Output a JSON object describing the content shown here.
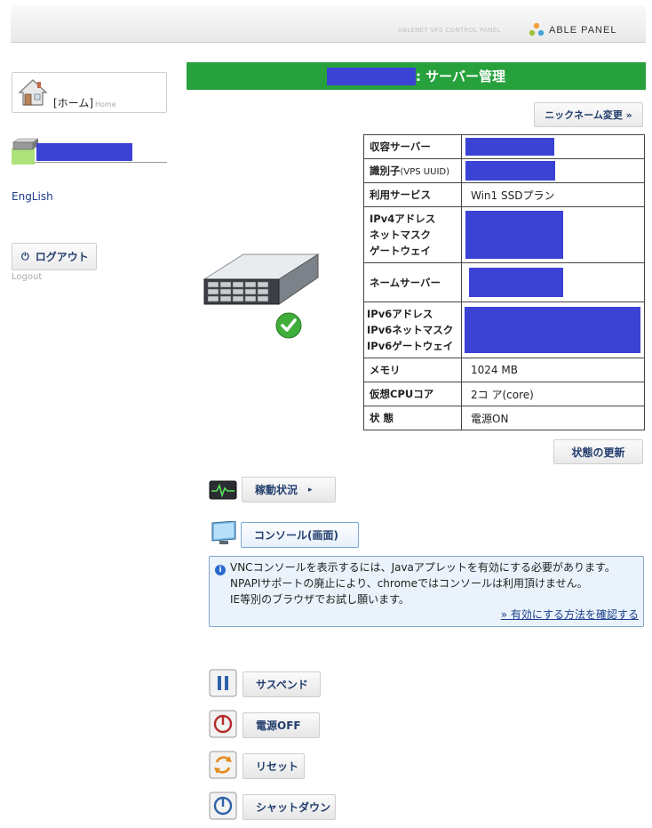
{
  "header": {
    "tagline": "ABLENET VPS CONTROL PANEL",
    "logo_text": "ABLE PANEL"
  },
  "sidebar": {
    "home_label": "[ホーム]",
    "home_sub": "Home",
    "english_link": "EngLish",
    "logout_label": "ログアウト",
    "logout_sub": "Logout"
  },
  "main": {
    "title_suffix": ": サーバー管理",
    "nickname_button": "ニックネーム変更 »",
    "update_button": "状態の更新"
  },
  "info_table": {
    "rows": [
      {
        "key": "収容サーバー",
        "value": ""
      },
      {
        "key": "識別子",
        "key_small": "(VPS UUID)",
        "value": ""
      },
      {
        "key": "利用サービス",
        "value": "Win1 SSDプラン"
      },
      {
        "key_lines": [
          "IPv4アドレス",
          "ネットマスク",
          "ゲートウェイ"
        ],
        "value": ""
      },
      {
        "key": "ネームサーバー",
        "value": ""
      },
      {
        "key_lines": [
          "IPv6アドレス",
          "IPv6ネットマスク",
          "IPv6ゲートウェイ"
        ],
        "value": ""
      },
      {
        "key": "メモリ",
        "value": "1024 MB"
      },
      {
        "key": "仮想CPUコア",
        "value": "2コ ア(core)"
      },
      {
        "key": "状 態",
        "value": "電源ON"
      }
    ]
  },
  "actions": {
    "status_label": "稼動状況",
    "console_label": "コンソール(画面)",
    "suspend_label": "サスペンド",
    "power_off_label": "電源OFF",
    "reset_label": "リセット",
    "shutdown_label": "シャットダウン"
  },
  "notice": {
    "line1": "VNCコンソールを表示するには、Javaアプレットを有効にする必要があります。",
    "line2": "NPAPIサポートの廃止により、chromeではコンソールは利用頂けません。",
    "line3": "IE等別のブラウザでお試し願います。",
    "link": "» 有効にする方法を確認する"
  },
  "colors": {
    "title_bar": "#27a13c",
    "redaction": "#3b43d5",
    "button_text": "#233e6e"
  },
  "icons": [
    "house-icon",
    "server-icon",
    "power-icon",
    "check-icon",
    "monitor-pulse-icon",
    "display-icon",
    "info-icon",
    "pause-icon",
    "power-off-icon",
    "reset-icon",
    "shutdown-icon"
  ]
}
